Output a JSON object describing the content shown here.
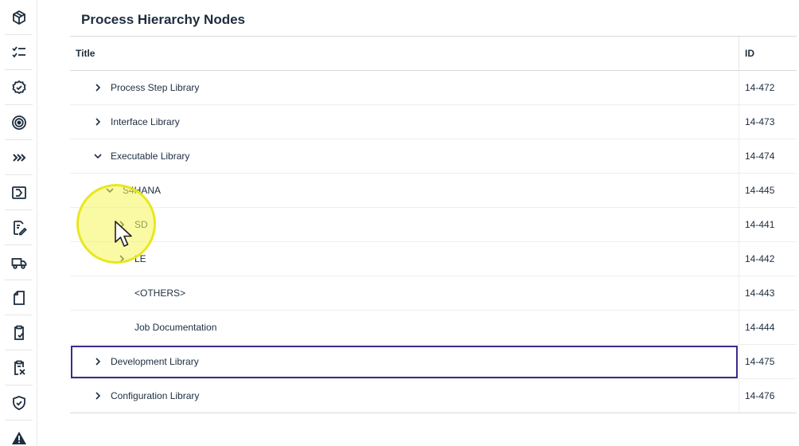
{
  "page": {
    "title": "Process Hierarchy Nodes"
  },
  "rail": {
    "items": [
      {
        "icon": "package-icon"
      },
      {
        "icon": "task-list-icon"
      },
      {
        "icon": "check-badge-icon"
      },
      {
        "icon": "target-icon"
      },
      {
        "icon": "chevrons-right-icon"
      },
      {
        "icon": "arrow-box-icon"
      },
      {
        "icon": "edit-document-icon"
      },
      {
        "icon": "truck-icon"
      },
      {
        "icon": "document-icon"
      },
      {
        "icon": "clipboard-check-icon"
      },
      {
        "icon": "checklist-x-icon"
      },
      {
        "icon": "shield-check-icon"
      },
      {
        "icon": "warning-icon"
      }
    ]
  },
  "table": {
    "columns": {
      "title": "Title",
      "id": "ID"
    },
    "rows": [
      {
        "label": "Process Step Library",
        "id": "14-472",
        "level": 0,
        "chevron": "right"
      },
      {
        "label": "Interface Library",
        "id": "14-473",
        "level": 0,
        "chevron": "right"
      },
      {
        "label": "Executable Library",
        "id": "14-474",
        "level": 0,
        "chevron": "down"
      },
      {
        "label": "S4HANA",
        "id": "14-445",
        "level": 1,
        "chevron": "down"
      },
      {
        "label": "SD",
        "id": "14-441",
        "level": 2,
        "chevron": "right"
      },
      {
        "label": "LE",
        "id": "14-442",
        "level": 2,
        "chevron": "right"
      },
      {
        "label": "<OTHERS>",
        "id": "14-443",
        "level": 2,
        "chevron": "none"
      },
      {
        "label": "Job Documentation",
        "id": "14-444",
        "level": 2,
        "chevron": "none"
      },
      {
        "label": "Development Library",
        "id": "14-475",
        "level": 0,
        "chevron": "right",
        "focused": true
      },
      {
        "label": "Configuration Library",
        "id": "14-476",
        "level": 0,
        "chevron": "right"
      }
    ]
  },
  "colors": {
    "focus": "#3b2a8c",
    "text": "#1d2d3e",
    "highlight": "#f5f55a"
  }
}
